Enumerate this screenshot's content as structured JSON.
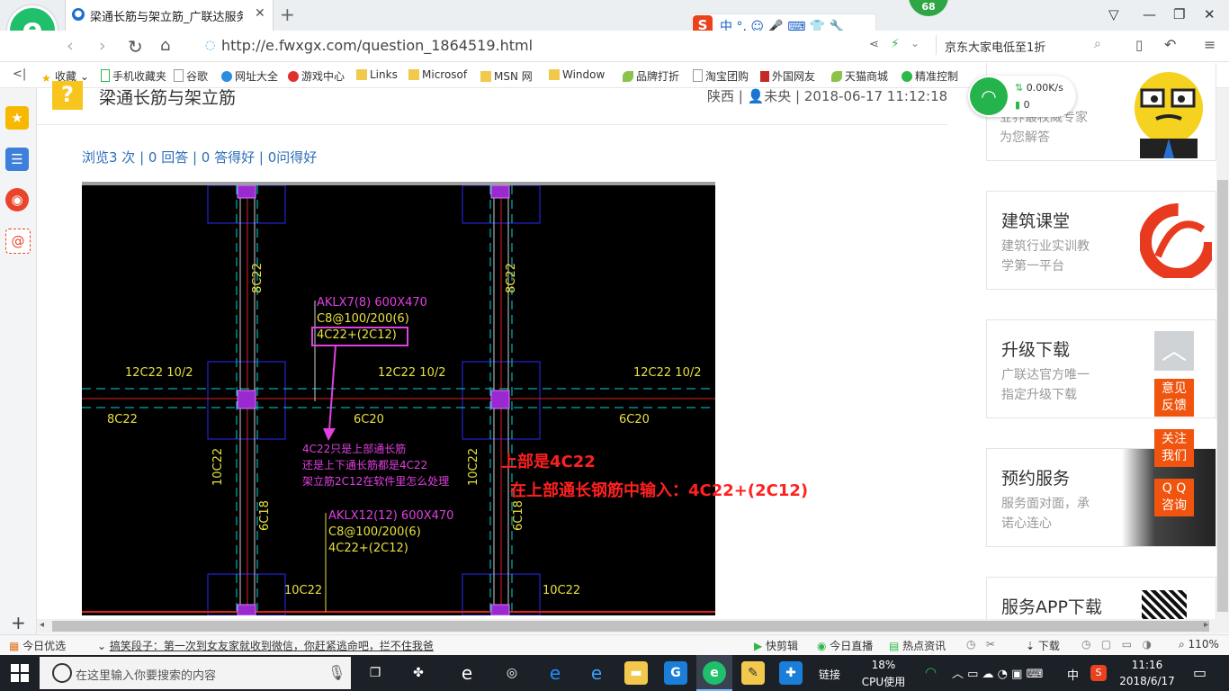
{
  "browser": {
    "tab_title": "梁通长筋与架立筋_广联达服务新",
    "badge_count": "68",
    "url": "http://e.fwxgx.com/question_1864519.html",
    "search_text": "京东大家电低至1折"
  },
  "bookmarks": [
    {
      "label": "收藏",
      "icon": "star-icon"
    },
    {
      "label": "手机收藏夹",
      "icon": "phone-icon"
    },
    {
      "label": "谷歌",
      "icon": "page-icon"
    },
    {
      "label": "网址大全",
      "icon": "globe-icon"
    },
    {
      "label": "游戏中心",
      "icon": "game-icon"
    },
    {
      "label": "Links",
      "icon": "folder-icon"
    },
    {
      "label": "Microsof",
      "icon": "folder-icon"
    },
    {
      "label": "MSN 网",
      "icon": "folder-icon"
    },
    {
      "label": "Window",
      "icon": "folder-icon"
    },
    {
      "label": "品牌打折",
      "icon": "leaf-icon"
    },
    {
      "label": "淘宝团购",
      "icon": "page-icon"
    },
    {
      "label": "外国网友",
      "icon": "bookmark-icon"
    },
    {
      "label": "天猫商城",
      "icon": "leaf-icon"
    },
    {
      "label": "精准控制",
      "icon": "chat-icon"
    }
  ],
  "question": {
    "title": "梁通长筋与架立筋",
    "meta": "陕西 | 👤未央 | 2018-06-17 11:12:18",
    "stats": "浏览3 次 | 0 回答 | 0 答得好 | 0问得好"
  },
  "cad": {
    "beam1_name": "AKLX7(8) 600X470",
    "beam1_stirrup": "C8@100/200(6)",
    "beam1_rebar": "4C22+(2C12)",
    "beam2_name": "AKLX12(12) 600X470",
    "beam2_stirrup": "C8@100/200(6)",
    "beam2_rebar": "4C22+(2C12)",
    "top_left": "12C22 10/2",
    "top_mid": "12C22 10/2",
    "top_right": "12C22 10/2",
    "bot_left": "8C22",
    "bot_mid": "6C20",
    "bot_right": "6C20",
    "col_top_left": "8C22",
    "col_top_right": "8C22",
    "col_mid_left": "10C22",
    "col_mid_right": "10C22",
    "col_low_left": "6C18",
    "col_low_right": "6C18",
    "bottom_left": "10C22",
    "bottom_right": "10C22",
    "question_line1": "4C22只是上部通长筋",
    "question_line2": "还是上下通长筋都是4C22",
    "question_line3": "架立筋2C12在软件里怎么处理"
  },
  "answer": {
    "line1": "上部是4C22",
    "line2": "在上部通长钢筋中输入：4C22+(2C12)"
  },
  "right_panel": {
    "card0_sub": "业界最权威专家 为您解答",
    "card1_title": "建筑课堂",
    "card1_sub": "建筑行业实训教 学第一平台",
    "card2_title": "升级下载",
    "card2_sub": "广联达官方唯一 指定升级下载",
    "card3_title": "预约服务",
    "card3_sub": "服务面对面，承 诺心连心",
    "card4_title": "服务APP下载",
    "btn_feedback": "意见 反馈",
    "btn_follow": "关注 我们",
    "btn_qq": "Q Q 咨询"
  },
  "net_widget": {
    "speed": "0.00K/s",
    "count": "0"
  },
  "statusbar": {
    "today": "今日优选",
    "news": "搞笑段子：第一次到女友家就收到微信，你赶紧逃命吧，拦不住我爸",
    "kuaijian": "快剪辑",
    "live": "今日直播",
    "hot": "热点资讯",
    "download": "下载",
    "zoom": "110%"
  },
  "taskbar": {
    "search_placeholder": "在这里输入你要搜索的内容",
    "link": "链接",
    "cpu_pct": "18%",
    "cpu_label": "CPU使用",
    "ime": "中",
    "time": "11:16",
    "date": "2018/6/17"
  },
  "colors": {
    "accent_green": "#1fbf6b",
    "link_blue": "#2d6fb8",
    "answer_red": "#ff2020",
    "cad_magenta": "#e040e0",
    "cad_yellow": "#e8e040"
  }
}
